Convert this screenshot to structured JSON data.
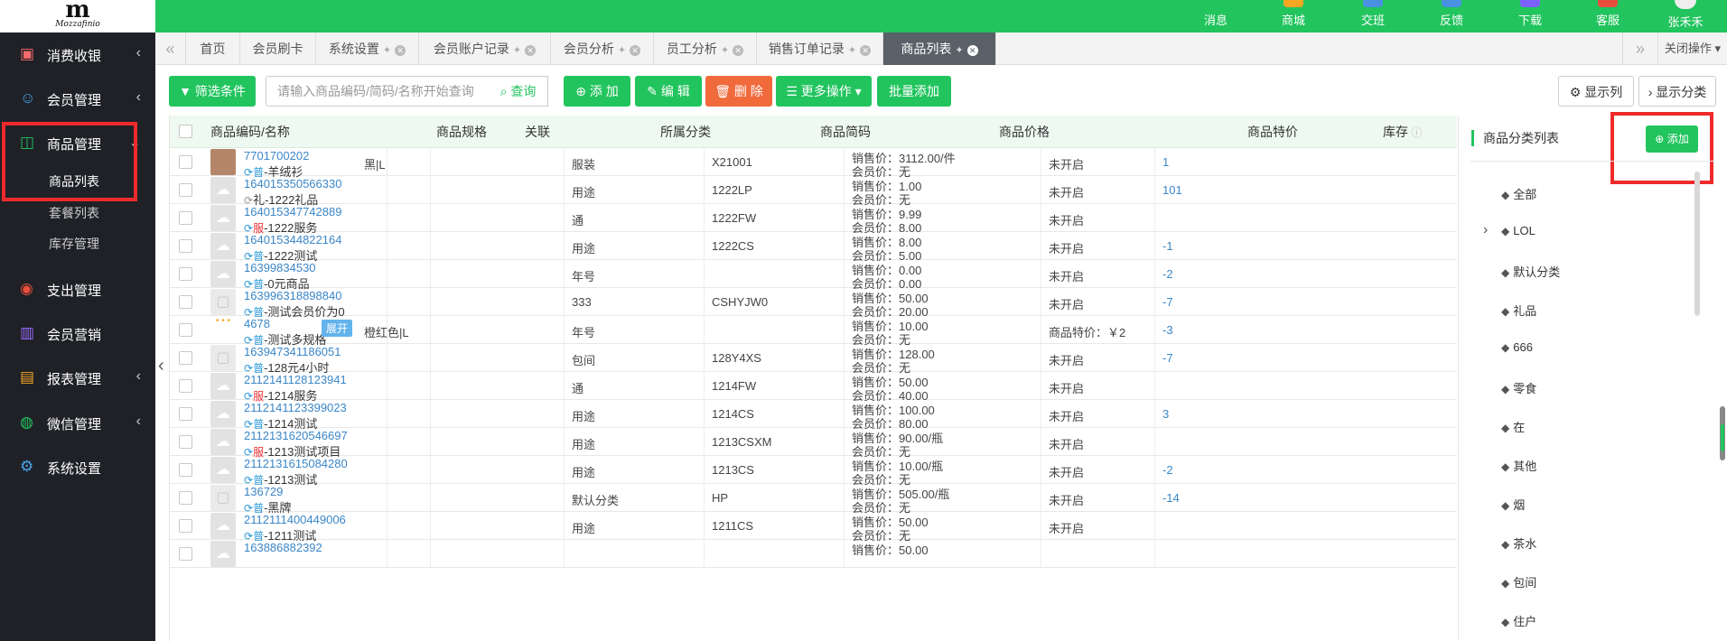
{
  "topbar": {
    "brand": "Mozzafinio",
    "items": [
      "消息",
      "商城",
      "交班",
      "反馈",
      "下载",
      "客服"
    ],
    "user": "张禾禾",
    "accent": "#22c45e"
  },
  "sidebar": {
    "items": [
      {
        "label": "消费收银",
        "icon": "cashier-icon"
      },
      {
        "label": "会员管理",
        "icon": "member-icon"
      },
      {
        "label": "商品管理",
        "icon": "goods-icon"
      },
      {
        "label": "支出管理",
        "icon": "expense-icon"
      },
      {
        "label": "会员营销",
        "icon": "gift-icon"
      },
      {
        "label": "报表管理",
        "icon": "report-icon"
      },
      {
        "label": "微信管理",
        "icon": "wechat-icon"
      },
      {
        "label": "系统设置",
        "icon": "gear-icon"
      }
    ],
    "sub": [
      "商品列表",
      "套餐列表",
      "库存管理"
    ]
  },
  "tabs": [
    {
      "label": "首页"
    },
    {
      "label": "会员刷卡"
    },
    {
      "label": "系统设置"
    },
    {
      "label": "会员账户记录"
    },
    {
      "label": "会员分析"
    },
    {
      "label": "员工分析"
    },
    {
      "label": "销售订单记录"
    },
    {
      "label": "商品列表"
    }
  ],
  "tabs_close_all": "关闭操作",
  "toolbar": {
    "filter": "筛选条件",
    "search_placeholder": "请输入商品编码/简码/名称开始查询",
    "search_btn": "查询",
    "add": "添 加",
    "edit": "编 辑",
    "del": "删 除",
    "more": "更多操作",
    "batch_add": "批量添加",
    "show_cols": "显示列",
    "show_cat": "显示分类"
  },
  "table": {
    "headers": [
      "商品编码/名称",
      "商品规格",
      "关联",
      "所属分类",
      "商品简码",
      "商品价格",
      "商品特价",
      "库存"
    ],
    "sale_prefix": "销售价：",
    "member_prefix": "会员价：",
    "expand_label": "展开",
    "rows": [
      {
        "code": "7701700202",
        "tag": "普",
        "tag_red": false,
        "name": "-羊绒衫",
        "spec": "黑|L",
        "cat": "服装",
        "short": "X21001",
        "sale": "3112.00/件",
        "member": "无",
        "special": "未开启",
        "stock": "1",
        "thumb": "photo"
      },
      {
        "code": "164015350566330",
        "tag": "",
        "tag_red": false,
        "name": "礼-1222礼品",
        "spec": "",
        "cat": "用途",
        "short": "1222LP",
        "sale": "1.00",
        "member": "无",
        "special": "未开启",
        "stock": "101",
        "thumb": "cloud"
      },
      {
        "code": "164015347742889",
        "tag": "服",
        "tag_red": true,
        "name": "-1222服务",
        "spec": "",
        "cat": "通",
        "short": "1222FW",
        "sale": "9.99",
        "member": "8.00",
        "special": "未开启",
        "stock": "",
        "thumb": "cloud"
      },
      {
        "code": "164015344822164",
        "tag": "普",
        "tag_red": false,
        "name": "-1222测试",
        "spec": "",
        "cat": "用途",
        "short": "1222CS",
        "sale": "8.00",
        "member": "5.00",
        "special": "未开启",
        "stock": "-1",
        "thumb": "cloud"
      },
      {
        "code": "16399834530",
        "tag": "普",
        "tag_red": false,
        "name": "-0元商品",
        "spec": "",
        "cat": "年号",
        "short": "",
        "sale": "0.00",
        "member": "0.00",
        "special": "未开启",
        "stock": "-2",
        "thumb": "cloud"
      },
      {
        "code": "163996318898840",
        "tag": "普",
        "tag_red": false,
        "name": "-测试会员价为0",
        "spec": "",
        "cat": "333",
        "short": "CSHYJW0",
        "sale": "50.00",
        "member": "20.00",
        "special": "未开启",
        "stock": "-7",
        "thumb": "bag"
      },
      {
        "code": "4678",
        "tag": "普",
        "tag_red": false,
        "name": "-测试多规格",
        "spec": "橙红色|L",
        "cat": "年号",
        "short": "",
        "sale": "10.00",
        "member": "无",
        "special": "商品特价：￥2",
        "stock": "-3",
        "thumb": "dots",
        "expand": true
      },
      {
        "code": "163947341186051",
        "tag": "普",
        "tag_red": false,
        "name": "-128元4小时",
        "spec": "",
        "cat": "包间",
        "short": "128Y4XS",
        "sale": "128.00",
        "member": "无",
        "special": "未开启",
        "stock": "-7",
        "thumb": "bag"
      },
      {
        "code": "2112141128123941",
        "tag": "服",
        "tag_red": true,
        "name": "-1214服务",
        "spec": "",
        "cat": "通",
        "short": "1214FW",
        "sale": "50.00",
        "member": "40.00",
        "special": "未开启",
        "stock": "",
        "thumb": "cloud"
      },
      {
        "code": "2112141123399023",
        "tag": "普",
        "tag_red": false,
        "name": "-1214测试",
        "spec": "",
        "cat": "用途",
        "short": "1214CS",
        "sale": "100.00",
        "member": "80.00",
        "special": "未开启",
        "stock": "3",
        "thumb": "cloud"
      },
      {
        "code": "2112131620546697",
        "tag": "服",
        "tag_red": true,
        "name": "-1213测试项目",
        "spec": "",
        "cat": "用途",
        "short": "1213CSXM",
        "sale": "90.00/瓶",
        "member": "无",
        "special": "未开启",
        "stock": "",
        "thumb": "cloud"
      },
      {
        "code": "2112131615084280",
        "tag": "普",
        "tag_red": false,
        "name": "-1213测试",
        "spec": "",
        "cat": "用途",
        "short": "1213CS",
        "sale": "10.00/瓶",
        "member": "无",
        "special": "未开启",
        "stock": "-2",
        "thumb": "cloud"
      },
      {
        "code": "136729",
        "tag": "普",
        "tag_red": false,
        "name": "-黑牌",
        "spec": "",
        "cat": "默认分类",
        "short": "HP",
        "sale": "505.00/瓶",
        "member": "无",
        "special": "未开启",
        "stock": "-14",
        "thumb": "bag"
      },
      {
        "code": "2112111400449006",
        "tag": "普",
        "tag_red": false,
        "name": "-1211测试",
        "spec": "",
        "cat": "用途",
        "short": "1211CS",
        "sale": "50.00",
        "member": "无",
        "special": "未开启",
        "stock": "",
        "thumb": "cloud"
      },
      {
        "code": "163886882392",
        "tag": "",
        "tag_red": false,
        "name": "",
        "spec": "",
        "cat": "",
        "short": "",
        "sale": "50.00",
        "member": "",
        "special": "",
        "stock": "",
        "thumb": "cloud"
      }
    ]
  },
  "category_panel": {
    "title": "商品分类列表",
    "add": "添加",
    "items": [
      "全部",
      "LOL",
      "默认分类",
      "礼品",
      "666",
      "零食",
      "在",
      "其他",
      "烟",
      "茶水",
      "包间",
      "住户"
    ]
  }
}
